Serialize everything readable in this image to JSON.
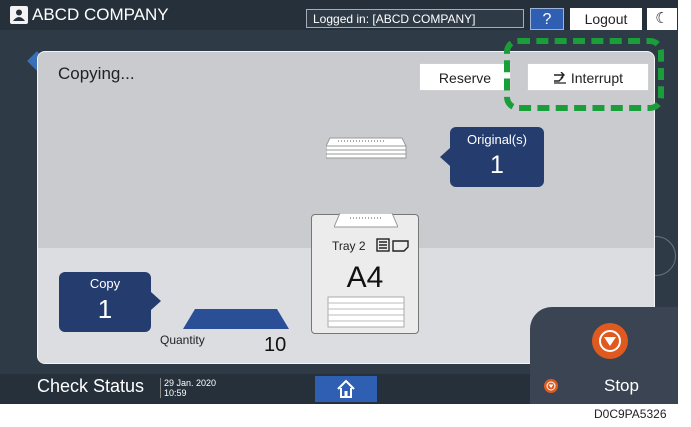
{
  "header": {
    "company": "ABCD COMPANY",
    "logged_in": "Logged in: [ABCD COMPANY]",
    "help_label": "?",
    "logout_label": "Logout"
  },
  "dialog": {
    "title": "Copying...",
    "reserve_label": "Reserve",
    "interrupt_label": "Interrupt",
    "originals_label": "Original(s)",
    "originals_count": "1",
    "tray_label": "Tray 2",
    "paper_size": "A4",
    "copy_label": "Copy",
    "copy_count": "1",
    "quantity_label": "Quantity",
    "quantity_value": "10"
  },
  "footer": {
    "check_status": "Check Status",
    "date": "29 Jan. 2020",
    "time": "10:59",
    "stop_label": "Stop"
  },
  "caption": "D0C9PA5326",
  "colors": {
    "accent_blue": "#2f5fb3",
    "navy_box": "#253d6e",
    "stop_orange": "#e05a20",
    "highlight_green": "#1a9e3a"
  },
  "icons": [
    "user-icon",
    "moon-icon",
    "interrupt-icon",
    "home-icon",
    "stop-icon",
    "paper-stack-icon",
    "paper-orientation-icon"
  ]
}
